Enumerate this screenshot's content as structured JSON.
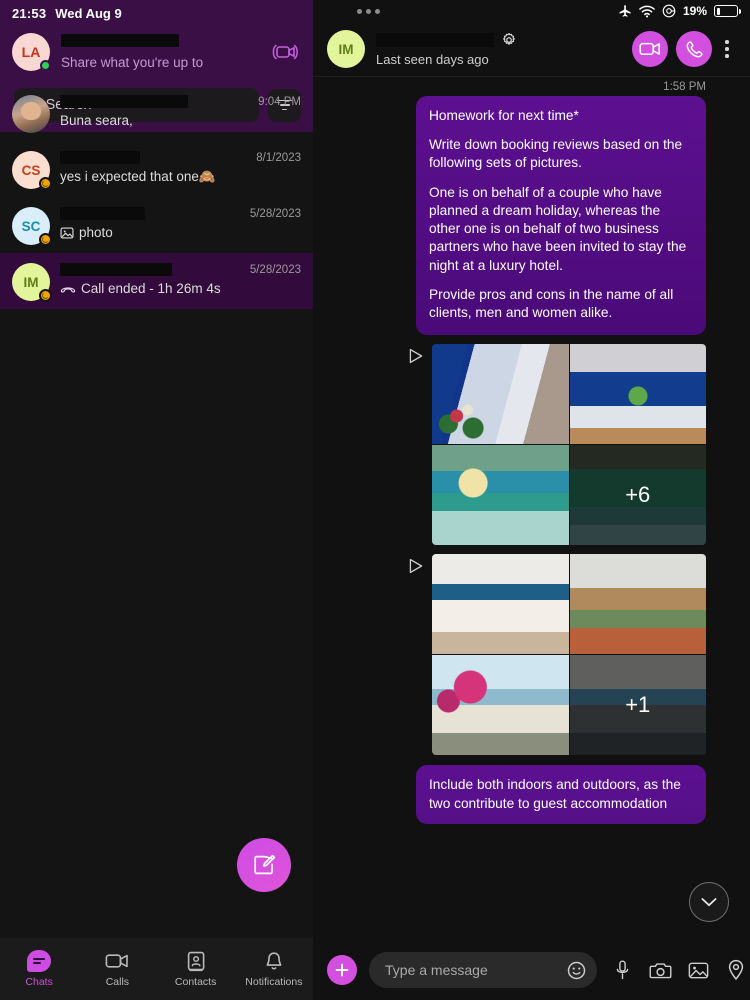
{
  "left_panel": {
    "status_bar": {
      "time": "21:53",
      "date": "Wed Aug 9"
    },
    "profile": {
      "avatar_initials": "LA",
      "name_redacted": true,
      "status_text": "Share what you're up to",
      "presence": "online",
      "new_video_call_icon": "video-camera-rotate-icon"
    },
    "search": {
      "placeholder": "Search",
      "value": "",
      "icon": "search-icon"
    },
    "filter": {
      "icon": "filter-icon"
    },
    "chats": [
      {
        "avatar_initials": "",
        "avatar_type": "photo",
        "name_redacted": true,
        "preview": "Buna seara,",
        "time": "9:04 PM",
        "selected": false,
        "presence": "none",
        "preview_icon": "none"
      },
      {
        "avatar_initials": "CS",
        "avatar_type": "initials",
        "name_redacted": true,
        "preview": "yes i expected that one🙈",
        "time": "8/1/2023",
        "selected": false,
        "presence": "away",
        "preview_icon": "none"
      },
      {
        "avatar_initials": "SC",
        "avatar_type": "initials",
        "name_redacted": true,
        "preview": "photo",
        "time": "5/28/2023",
        "selected": false,
        "presence": "away",
        "preview_icon": "image-icon"
      },
      {
        "avatar_initials": "IM",
        "avatar_type": "initials",
        "name_redacted": true,
        "preview": "Call ended - 1h 26m 4s",
        "time": "5/28/2023",
        "selected": true,
        "presence": "away",
        "preview_icon": "call-ended-icon"
      }
    ],
    "compose_fab": {
      "icon": "compose-pencil-icon"
    },
    "tabs": [
      {
        "label": "Chats",
        "icon": "chat-bubble-icon",
        "active": true
      },
      {
        "label": "Calls",
        "icon": "video-camera-icon",
        "active": false
      },
      {
        "label": "Contacts",
        "icon": "contacts-book-icon",
        "active": false
      },
      {
        "label": "Notifications",
        "icon": "bell-icon",
        "active": false
      }
    ]
  },
  "right_panel": {
    "status_bar": {
      "menu_icon": "three-dots-icon",
      "airplane_icon": "airplane-mode-icon",
      "wifi_icon": "wifi-icon",
      "dnd_icon": "do-not-disturb-icon",
      "battery_percent": "19%"
    },
    "conversation_header": {
      "avatar_initials": "IM",
      "name_redacted": true,
      "settings_icon": "gear-icon",
      "subtitle": "Last seen days ago",
      "video_call_icon": "video-camera-icon",
      "voice_call_icon": "phone-icon",
      "more_icon": "kebab-menu-icon"
    },
    "messages": [
      {
        "type": "text",
        "time": "1:58 PM",
        "paragraphs": [
          "Homework for next time*",
          "Write down booking reviews based on the following sets of pictures.",
          "One is on behalf of a couple who have planned a dream holiday, whereas the other one is on behalf of two business partners who have been invited to stay the night at a luxury hotel.",
          "Provide pros and cons in the name of all clients, men and women alike."
        ]
      },
      {
        "type": "album",
        "forwarded_icon": "forwarded-arrow-icon",
        "overflow_label": "+6",
        "photo_count": 4
      },
      {
        "type": "album",
        "forwarded_icon": "forwarded-arrow-icon",
        "overflow_label": "+1",
        "photo_count": 4
      },
      {
        "type": "text",
        "paragraphs": [
          "Include both indoors and outdoors, as the two contribute to guest accommodation"
        ]
      }
    ],
    "scroll_down_button": {
      "icon": "chevron-down-icon"
    },
    "composer": {
      "add_icon": "plus-icon",
      "placeholder": "Type a message",
      "value": "",
      "emoji_icon": "smiley-icon",
      "mic_icon": "microphone-icon",
      "camera_icon": "camera-icon",
      "gallery_icon": "image-icon",
      "location_icon": "location-pin-icon"
    }
  },
  "colors": {
    "accent": "#d24fe0",
    "bubble": "#5c0f8f",
    "sidebar_header": "#3a0f46",
    "selected_row": "#330a3c",
    "app_bg": "#111111"
  }
}
